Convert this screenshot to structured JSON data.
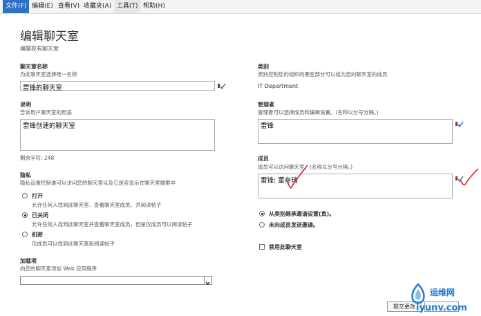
{
  "menu": {
    "file": "文件(F)",
    "edit": "编辑(E)",
    "view": "查看(V)",
    "favorites": "收藏夹(A)",
    "tools": "工具(T)",
    "help": "帮助(H)"
  },
  "page": {
    "title": "编辑聊天室",
    "subtitle": "编辑现有聊天室"
  },
  "name_section": {
    "label": "聊天室名称",
    "description": "为此聊天室选择唯一名称",
    "value": "雷锋的聊天室"
  },
  "desc_section": {
    "label": "说明",
    "description": "告诉用户聊天室的用途",
    "value": "雷锋创建的聊天室",
    "remaining": "剩余字符:  248"
  },
  "privacy_section": {
    "label": "隐私",
    "description": "隐私设置控制谁可以访问您的聊天室以及它是否显示在聊天室搜索中",
    "options": [
      {
        "label": "打开",
        "description": "允许任何人找到此聊天室、查看聊天室成员、并阅读帖子"
      },
      {
        "label": "已关闭",
        "description": "允许任何人找到此聊天室并查看聊天室成员，但是仅成员可以阅读帖子"
      },
      {
        "label": "机密",
        "description": "仅成员可以找到此聊天室和阅读帖子"
      }
    ],
    "selected": 1
  },
  "addins_section": {
    "label": "加载项",
    "description": "向您的聊天室添加 Web 应用程序",
    "selected_value": ""
  },
  "category_section": {
    "label": "类别",
    "description": "类别控制您的组织的哪些部分可以成为您的聊天室的成员",
    "value": "IT Department"
  },
  "managers_section": {
    "label": "管理者",
    "description": "管理者可以选择成员和编辑设置。(名称以分号分隔。)",
    "value": "雷锋"
  },
  "members_section": {
    "label": "成员",
    "description": "成员可以访问聊天室。(名称以分号分隔。)",
    "value": "雷锋; 董存瑞"
  },
  "invitations": {
    "options": [
      "从类别继承邀请设置(真)。",
      "未向成员发送邀请。"
    ],
    "selected": 0
  },
  "disable": {
    "label": "禁用此聊天室",
    "checked": false
  },
  "footer": {
    "commit_button": "提交更改",
    "watermark_text": "运维网",
    "watermark_url": "iyunv.com"
  },
  "colors": {
    "menu_active": "#2f6fc4",
    "annotation_red": "#d9232b",
    "watermark_blue": "#1c7bd4"
  }
}
